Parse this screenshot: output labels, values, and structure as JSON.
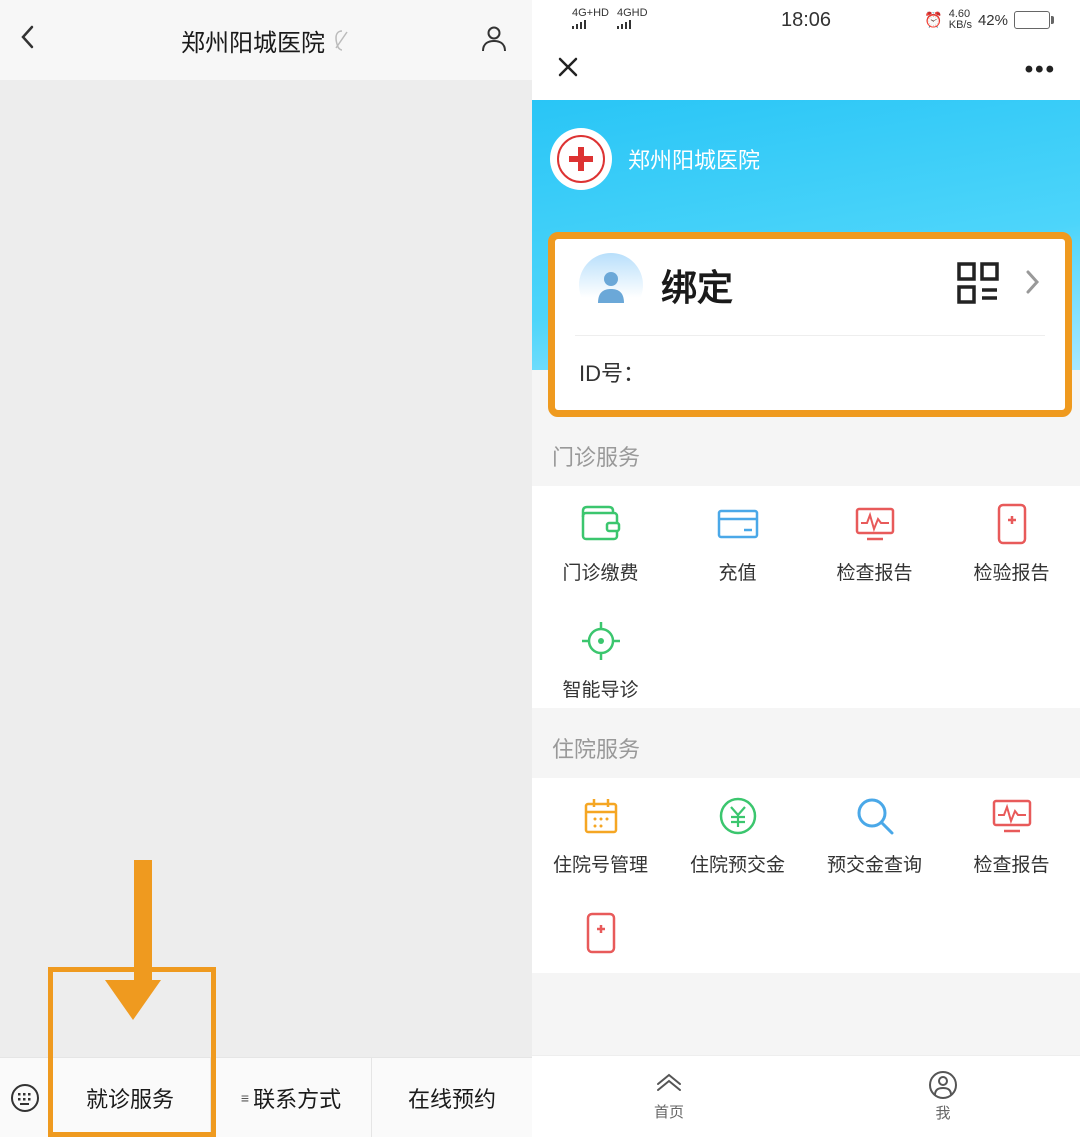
{
  "left": {
    "title": "郑州阳城医院",
    "bottom_menu": {
      "item1": "就诊服务",
      "item2_prefix": "≡",
      "item2": "联系方式",
      "item3": "在线预约"
    }
  },
  "right": {
    "status": {
      "signal1": "4G+HD",
      "signal2": "4GHD",
      "time": "18:06",
      "net_speed_value": "4.60",
      "net_speed_unit": "KB/s",
      "battery_pct": "42%"
    },
    "hospital_name": "郑州阳城医院",
    "card": {
      "bind_label": "绑定",
      "id_label": "ID号："
    },
    "section1_title": "门诊服务",
    "section1_items": [
      {
        "label": "门诊缴费"
      },
      {
        "label": "充值"
      },
      {
        "label": "检查报告"
      },
      {
        "label": "检验报告"
      },
      {
        "label": "智能导诊"
      }
    ],
    "section2_title": "住院服务",
    "section2_items": [
      {
        "label": "住院号管理"
      },
      {
        "label": "住院预交金"
      },
      {
        "label": "预交金查询"
      },
      {
        "label": "检查报告"
      }
    ],
    "nav": {
      "home": "首页",
      "me": "我"
    }
  }
}
